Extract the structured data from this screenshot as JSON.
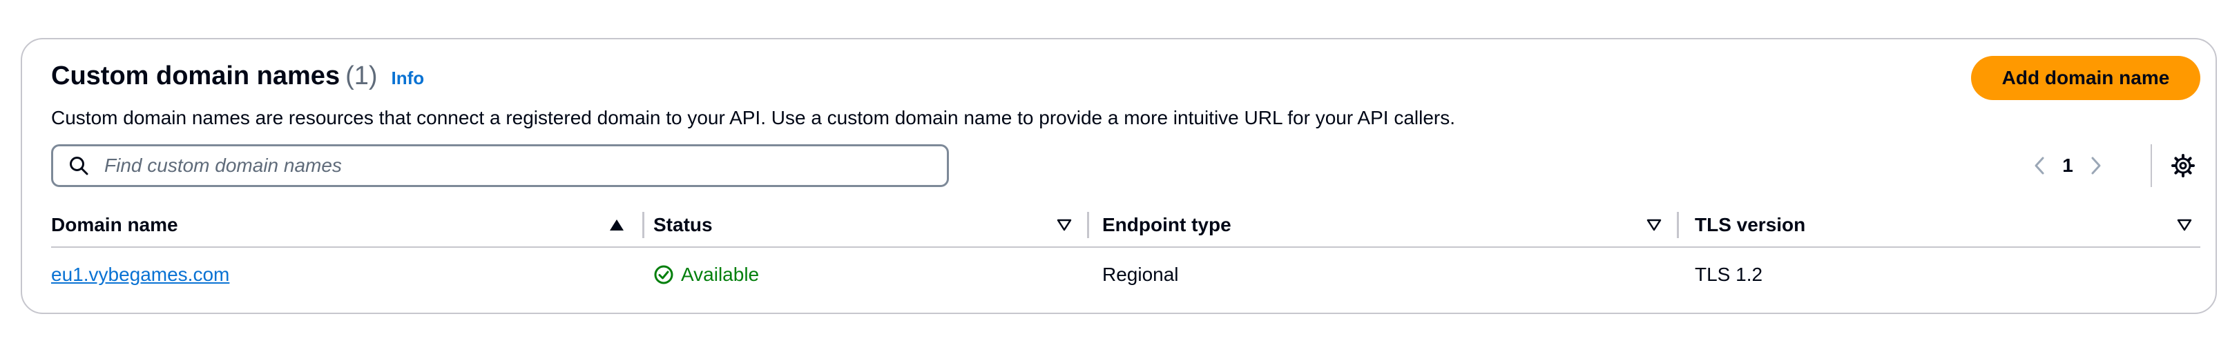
{
  "header": {
    "title": "Custom domain names",
    "count": "(1)",
    "info_label": "Info",
    "description": "Custom domain names are resources that connect a registered domain to your API. Use a custom domain name to provide a more intuitive URL for your API callers.",
    "add_button_label": "Add domain name"
  },
  "search": {
    "placeholder": "Find custom domain names",
    "value": ""
  },
  "pagination": {
    "current_page": "1"
  },
  "table": {
    "columns": [
      {
        "label": "Domain name",
        "sort": "ascending"
      },
      {
        "label": "Status",
        "sort": "none"
      },
      {
        "label": "Endpoint type",
        "sort": "none"
      },
      {
        "label": "TLS version",
        "sort": "none"
      }
    ],
    "rows": [
      {
        "domain_name": "eu1.vybegames.com",
        "status": "Available",
        "endpoint_type": "Regional",
        "tls_version": "TLS 1.2"
      }
    ]
  },
  "icons": {
    "search": "search-icon",
    "prev": "chevron-left-icon",
    "next": "chevron-right-icon",
    "settings": "gear-icon",
    "sort_asc": "caret-up-filled-icon",
    "sort_none": "caret-down-outline-icon",
    "status_ok": "check-circle-icon"
  },
  "colors": {
    "accent": "#ff9900",
    "link": "#0972d3",
    "success": "#037f0c",
    "border": "#c6c6cd",
    "muted": "#5f6b7a"
  }
}
